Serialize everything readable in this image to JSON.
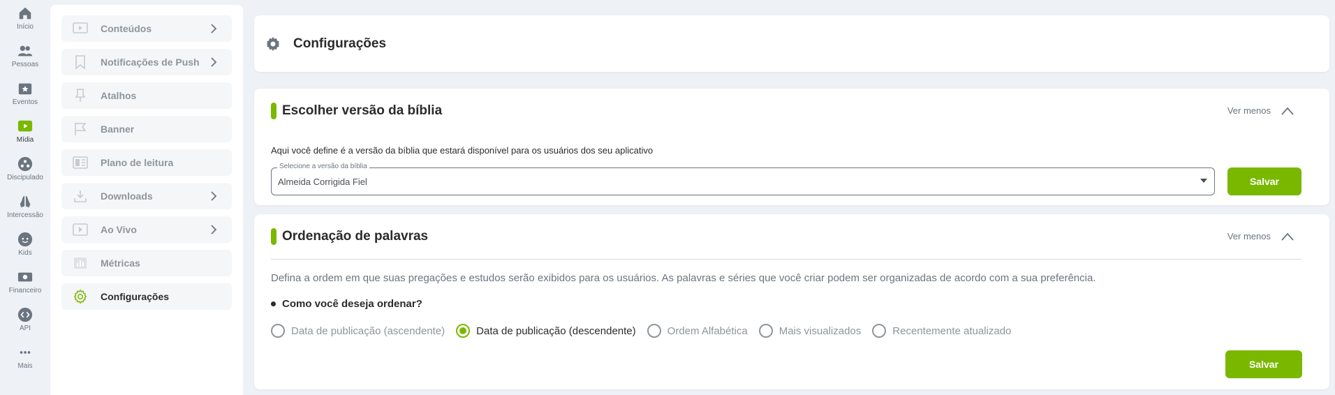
{
  "rail": {
    "items": [
      {
        "label": "Início"
      },
      {
        "label": "Pessoas"
      },
      {
        "label": "Eventos"
      },
      {
        "label": "Mídia"
      },
      {
        "label": "Discipulado"
      },
      {
        "label": "Intercessão"
      },
      {
        "label": "Kids"
      },
      {
        "label": "Financeiro"
      },
      {
        "label": "API"
      },
      {
        "label": "Mais"
      }
    ],
    "active": "Mídia",
    "accent": "#7ab800"
  },
  "sidebar": {
    "items": [
      {
        "label": "Conteúdos",
        "has_chevron": true
      },
      {
        "label": "Notificações de Push",
        "has_chevron": true
      },
      {
        "label": "Atalhos",
        "has_chevron": false
      },
      {
        "label": "Banner",
        "has_chevron": false
      },
      {
        "label": "Plano de leitura",
        "has_chevron": false
      },
      {
        "label": "Downloads",
        "has_chevron": true
      },
      {
        "label": "Ao Vivo",
        "has_chevron": true
      },
      {
        "label": "Métricas",
        "has_chevron": false
      },
      {
        "label": "Configurações",
        "has_chevron": false
      }
    ],
    "active": "Configurações"
  },
  "page": {
    "title": "Configurações"
  },
  "bible": {
    "title": "Escolher versão da bíblia",
    "toggle": "Ver menos",
    "description": "Aqui você define é a versão da bíblia que estará disponível para os usuários dos seu aplicativo",
    "select_label": "Selecione a versão da bíblia",
    "select_value": "Almeida Corrigida Fiel",
    "save": "Salvar"
  },
  "order": {
    "title": "Ordenação de palavras",
    "toggle": "Ver menos",
    "description": "Defina a ordem em que suas pregações e estudos serão exibidos para os usuários. As palavras e séries que você criar podem ser organizadas de acordo com a sua preferência.",
    "question": "Como você deseja ordenar?",
    "options": [
      {
        "label": "Data de publicação (ascendente)",
        "checked": false
      },
      {
        "label": "Data de publicação (descendente)",
        "checked": true
      },
      {
        "label": "Ordem Alfabética",
        "checked": false
      },
      {
        "label": "Mais visualizados",
        "checked": false
      },
      {
        "label": "Recentemente atualizado",
        "checked": false
      }
    ],
    "save": "Salvar"
  }
}
